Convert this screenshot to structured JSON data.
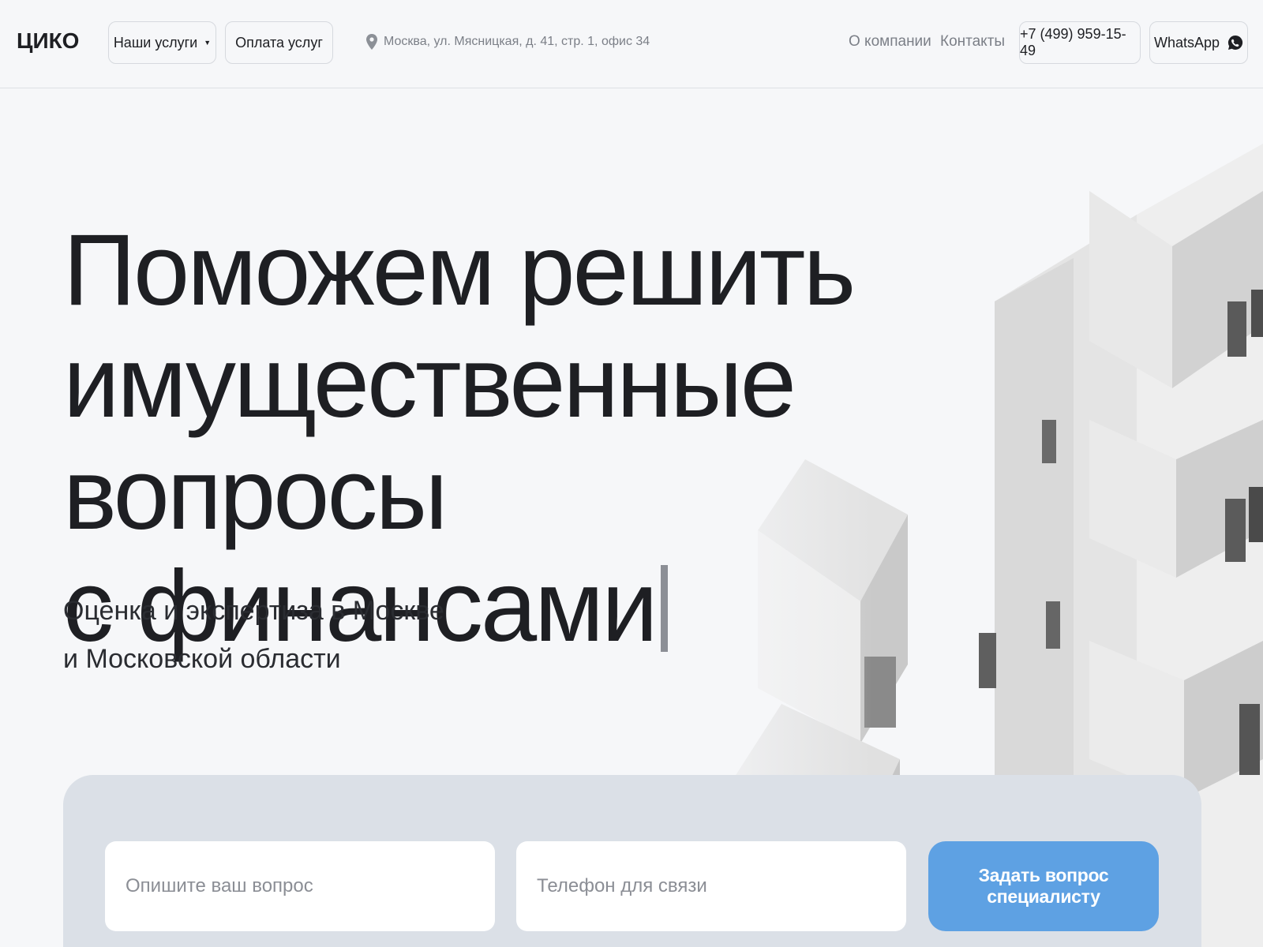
{
  "header": {
    "logo": "ЦИКО",
    "services_label": "Наши услуги",
    "payment_label": "Оплата услуг",
    "address": "Москва, ул. Мясницкая, д. 41, стр. 1, офис 34",
    "nav": {
      "about": "О компании",
      "contacts": "Контакты"
    },
    "phone": "+7 (499) 959-15-49",
    "whatsapp_label": "WhatsApp"
  },
  "hero": {
    "title_lines": [
      "Поможем решить",
      "имущественные вопросы",
      "с финансами"
    ],
    "subtitle_lines": [
      "Оценка и экспертиза в Москве",
      "и Московской области"
    ]
  },
  "form": {
    "question_placeholder": "Опишите ваш вопрос",
    "phone_placeholder": "Телефон для связи",
    "submit_label": "Задать вопрос специалисту"
  },
  "icons": {
    "location": "pin-icon",
    "whatsapp": "whatsapp-icon",
    "dropdown": "caret-down-icon"
  },
  "colors": {
    "accent": "#5ea1e3",
    "page_bg": "#f6f7f9",
    "panel_bg": "#dbe0e7",
    "text": "#1e1f23",
    "muted": "#7b7f87"
  }
}
